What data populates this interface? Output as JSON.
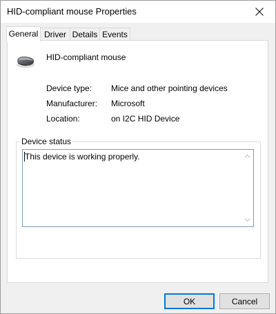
{
  "window": {
    "title": "HID-compliant mouse Properties"
  },
  "tabs": [
    {
      "label": "General",
      "active": true
    },
    {
      "label": "Driver",
      "active": false
    },
    {
      "label": "Details",
      "active": false
    },
    {
      "label": "Events",
      "active": false
    }
  ],
  "device": {
    "name": "HID-compliant mouse",
    "icon": "mouse-icon",
    "properties": [
      {
        "label": "Device type:",
        "value": "Mice and other pointing devices"
      },
      {
        "label": "Manufacturer:",
        "value": "Microsoft"
      },
      {
        "label": "Location:",
        "value": "on I2C HID Device"
      }
    ]
  },
  "device_status": {
    "group_label": "Device status",
    "text": "This device is working properly."
  },
  "buttons": {
    "ok_label": "OK",
    "cancel_label": "Cancel"
  },
  "colors": {
    "accent": "#0078d7",
    "panel_bg": "#ffffff",
    "window_bg": "#f0f0f0"
  }
}
